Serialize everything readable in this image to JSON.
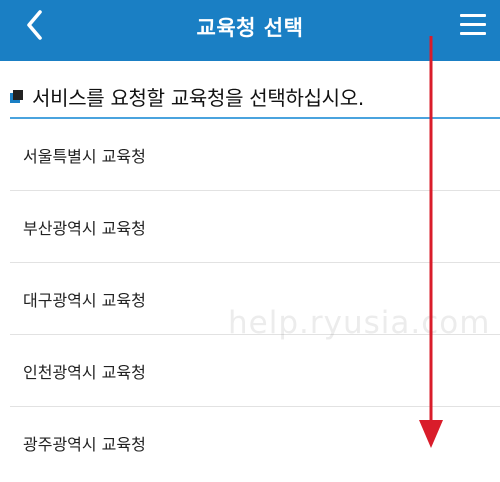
{
  "header": {
    "title": "교육청 선택",
    "back_icon": "chevron-left-icon",
    "menu_icon": "hamburger-menu-icon"
  },
  "instruction": {
    "text": "서비스를 요청할 교육청을 선택하십시오."
  },
  "offices": [
    "서울특별시 교육청",
    "부산광역시 교육청",
    "대구광역시 교육청",
    "인천광역시 교육청",
    "광주광역시 교육청"
  ],
  "watermark": "help.ryusia.com",
  "colors": {
    "header_bg": "#1a7fc4",
    "accent_rule": "#4aa3de",
    "annotation_arrow": "#d91c2a"
  }
}
